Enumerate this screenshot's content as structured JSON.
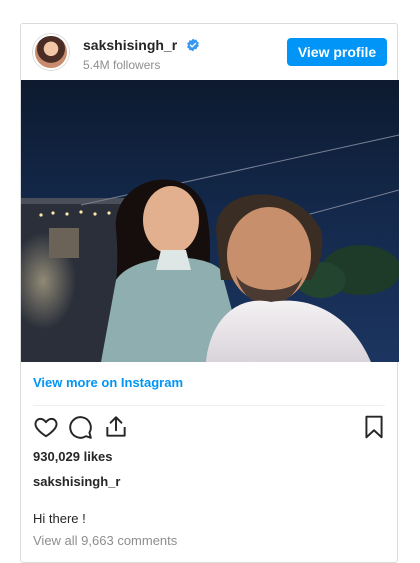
{
  "header": {
    "username": "sakshisingh_r",
    "followers": "5.4M followers",
    "view_profile_label": "View profile"
  },
  "post": {
    "view_more_label": "View more on Instagram",
    "likes": "930,029 likes",
    "caption_user": "sakshisingh_r",
    "caption_text": "Hi there !",
    "comments_link": "View all 9,663 comments"
  },
  "icons": {
    "verified": "verified-badge-icon",
    "like": "heart-icon",
    "comment": "comment-icon",
    "share": "share-icon",
    "save": "bookmark-icon"
  },
  "colors": {
    "accent": "#0095f6",
    "secondary_text": "#8e8e8e"
  }
}
